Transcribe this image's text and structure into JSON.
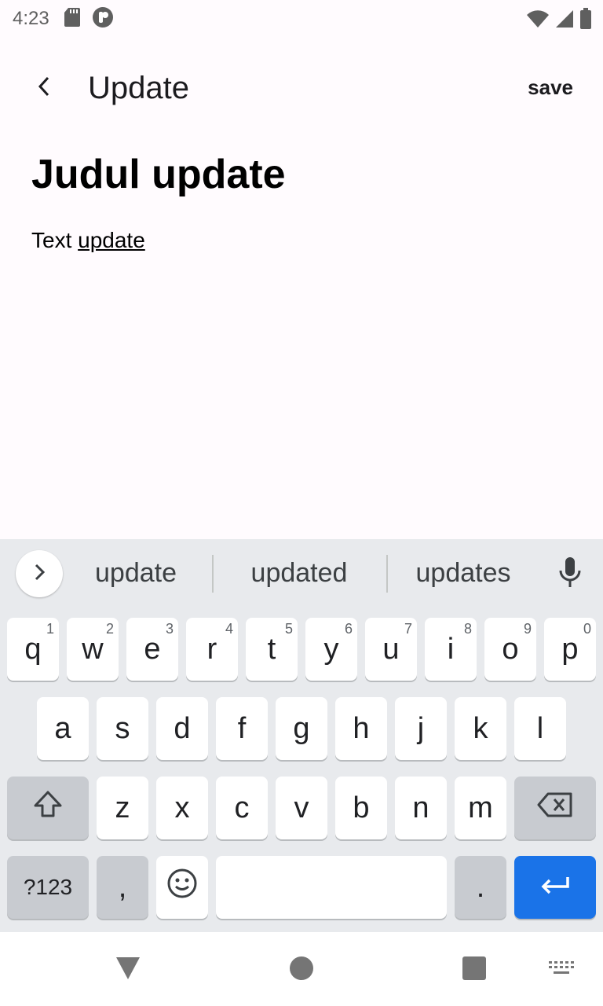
{
  "status_bar": {
    "time": "4:23",
    "icons_left": [
      "sd-card-icon",
      "app-notification-icon"
    ],
    "icons_right": [
      "wifi-icon",
      "signal-icon",
      "battery-icon"
    ]
  },
  "app_bar": {
    "title": "Update",
    "save_label": "save"
  },
  "note": {
    "title": "Judul update",
    "body_prefix": "Text ",
    "body_underlined": "update"
  },
  "keyboard": {
    "suggestions": [
      "update",
      "updated",
      "updates"
    ],
    "row1": [
      {
        "label": "q",
        "sup": "1"
      },
      {
        "label": "w",
        "sup": "2"
      },
      {
        "label": "e",
        "sup": "3"
      },
      {
        "label": "r",
        "sup": "4"
      },
      {
        "label": "t",
        "sup": "5"
      },
      {
        "label": "y",
        "sup": "6"
      },
      {
        "label": "u",
        "sup": "7"
      },
      {
        "label": "i",
        "sup": "8"
      },
      {
        "label": "o",
        "sup": "9"
      },
      {
        "label": "p",
        "sup": "0"
      }
    ],
    "row2": [
      "a",
      "s",
      "d",
      "f",
      "g",
      "h",
      "j",
      "k",
      "l"
    ],
    "row3": [
      "z",
      "x",
      "c",
      "v",
      "b",
      "n",
      "m"
    ],
    "symbols_label": "?123",
    "comma_label": ",",
    "period_label": ".",
    "accent_color": "#1a73e8"
  },
  "nav_bar": {
    "buttons": [
      "back-triangle-icon",
      "home-circle-icon",
      "recents-square-icon",
      "keyboard-switch-icon"
    ]
  }
}
